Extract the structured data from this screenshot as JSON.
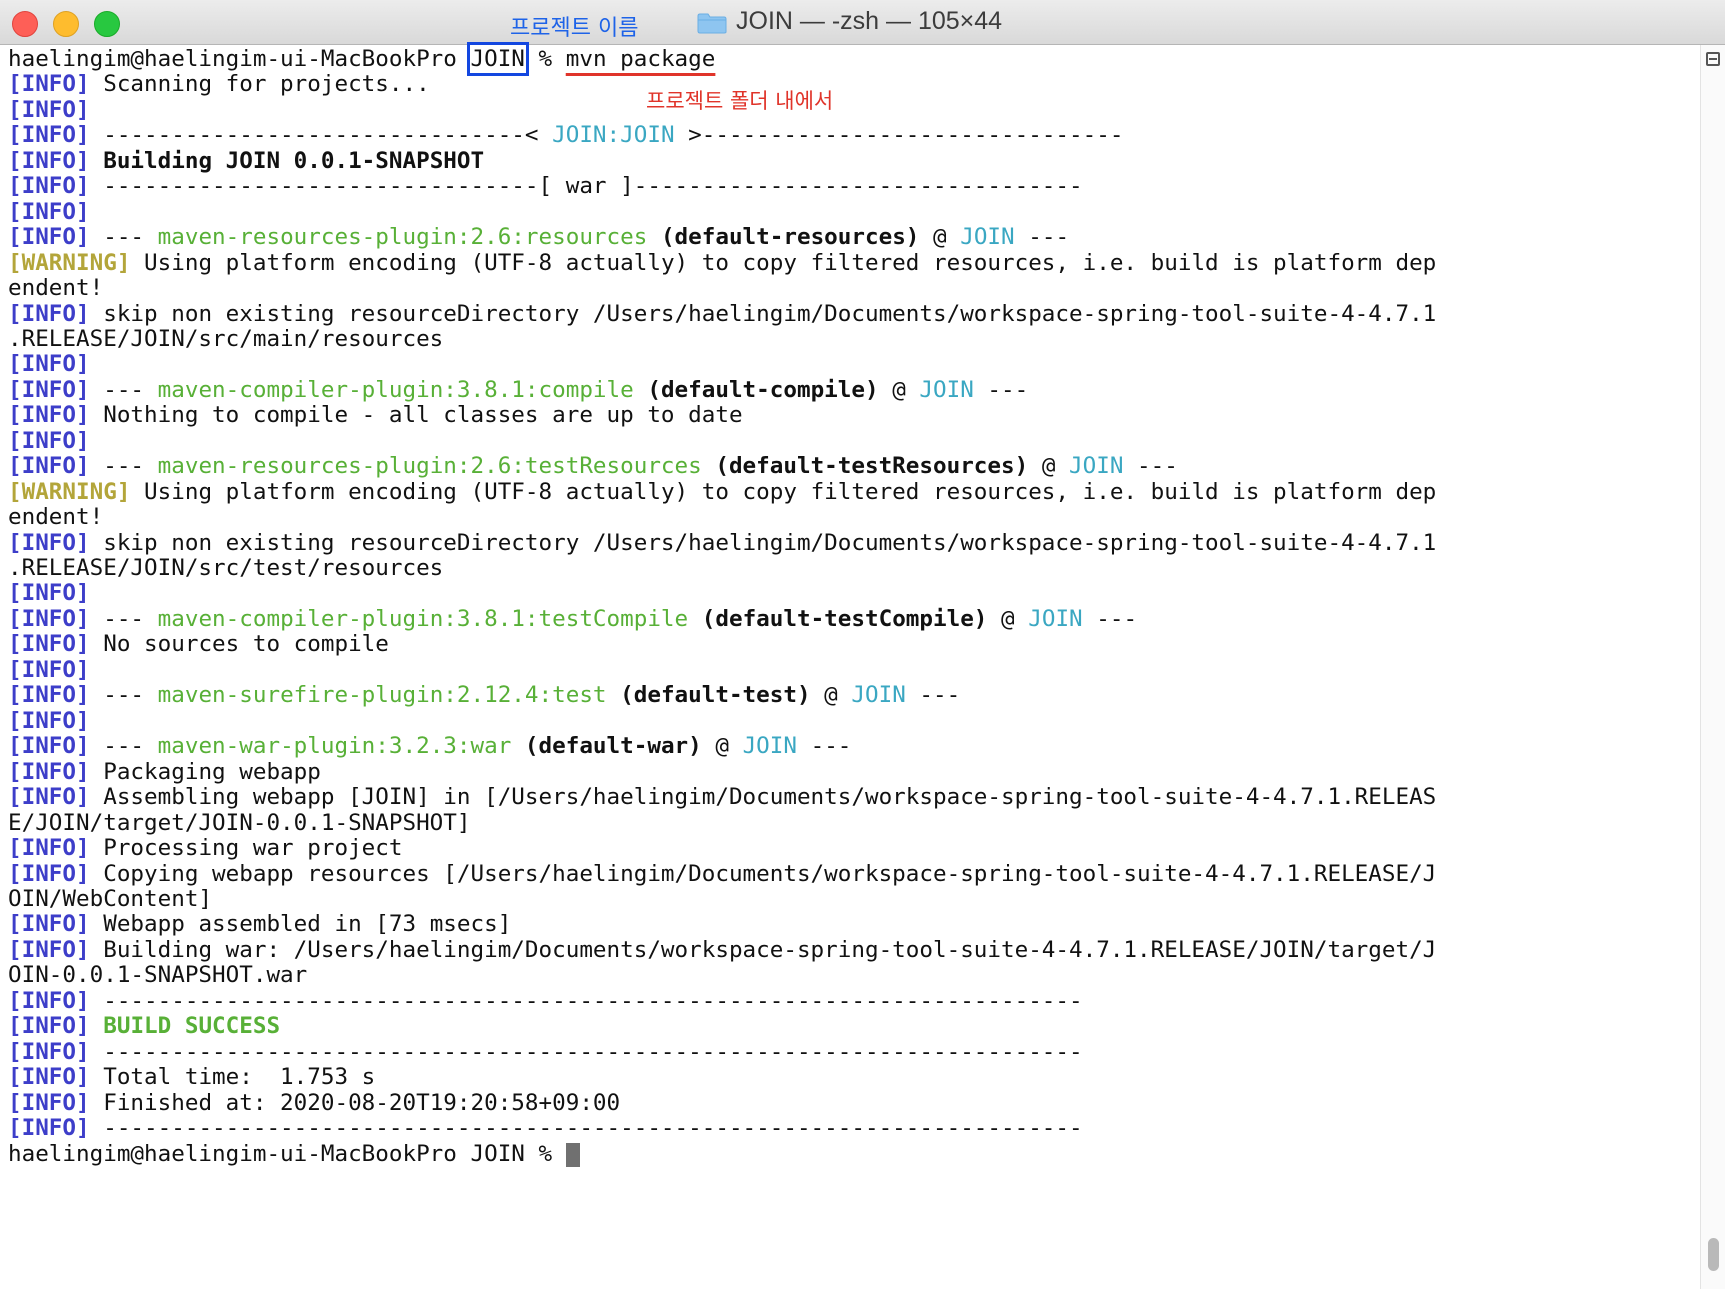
{
  "window": {
    "title": "JOIN — -zsh — 105×44",
    "annotation_project_name": "프로젝트 이름",
    "annotation_in_project_folder": "프로젝트 폴더 내에서"
  },
  "colors": {
    "info_tag": "#3d3ec9",
    "warning_tag": "#b3a53a",
    "plugin_green": "#58b037",
    "project_cyan": "#3aa7c2",
    "annotation_blue": "#1e63e8",
    "annotation_red": "#e0342a"
  },
  "terminal": {
    "prompt_user": "haelingim@haelingim-ui-MacBookPro ",
    "prompt_dir": "JOIN",
    "prompt_sign": " % ",
    "command": "mvn package",
    "lines": {
      "info": "[INFO]",
      "warning": "[WARNING]",
      "l1": " Scanning for projects...",
      "sep_a_left": " -------------------------------< ",
      "sep_a_mid": "JOIN:JOIN",
      "sep_a_right": " >-------------------------------",
      "building": " Building JOIN 0.0.1-SNAPSHOT",
      "sep_b": " --------------------------------[ war ]---------------------------------",
      "dash3": " --- ",
      "plugin_resources": "maven-resources-plugin:2.6:resources",
      "exec_resources": " (default-resources)",
      "at": " @ ",
      "project": "JOIN",
      "dash3_end": " ---",
      "warn_encoding": " Using platform encoding (UTF-8 actually) to copy filtered resources, i.e. build is platform dep",
      "warn_encoding_cont": "endent!",
      "skip_main": " skip non existing resourceDirectory /Users/haelingim/Documents/workspace-spring-tool-suite-4-4.7.1",
      "skip_main_cont": ".RELEASE/JOIN/src/main/resources",
      "plugin_compile": "maven-compiler-plugin:3.8.1:compile",
      "exec_compile": " (default-compile)",
      "nothing_compile": " Nothing to compile - all classes are up to date",
      "plugin_test_resources": "maven-resources-plugin:2.6:testResources",
      "exec_test_resources": " (default-testResources)",
      "skip_test": " skip non existing resourceDirectory /Users/haelingim/Documents/workspace-spring-tool-suite-4-4.7.1",
      "skip_test_cont": ".RELEASE/JOIN/src/test/resources",
      "plugin_test_compile": "maven-compiler-plugin:3.8.1:testCompile",
      "exec_test_compile": " (default-testCompile)",
      "no_sources": " No sources to compile",
      "plugin_surefire": "maven-surefire-plugin:2.12.4:test",
      "exec_test": " (default-test)",
      "plugin_war": "maven-war-plugin:3.2.3:war",
      "exec_war": " (default-war)",
      "packaging": " Packaging webapp",
      "assembling": " Assembling webapp [JOIN] in [/Users/haelingim/Documents/workspace-spring-tool-suite-4-4.7.1.RELEAS",
      "assembling_cont": "E/JOIN/target/JOIN-0.0.1-SNAPSHOT]",
      "processing": " Processing war project",
      "copying": " Copying webapp resources [/Users/haelingim/Documents/workspace-spring-tool-suite-4-4.7.1.RELEASE/J",
      "copying_cont": "OIN/WebContent]",
      "assembled": " Webapp assembled in [73 msecs]",
      "building_war": " Building war: /Users/haelingim/Documents/workspace-spring-tool-suite-4-4.7.1.RELEASE/JOIN/target/J",
      "building_war_cont": "OIN-0.0.1-SNAPSHOT.war",
      "sep_long": " ------------------------------------------------------------------------",
      "build_success": "BUILD SUCCESS",
      "total_time": " Total time:  1.753 s",
      "finished_at": " Finished at: 2020-08-20T19:20:58+09:00",
      "final_prompt": "haelingim@haelingim-ui-MacBookPro JOIN % "
    }
  }
}
